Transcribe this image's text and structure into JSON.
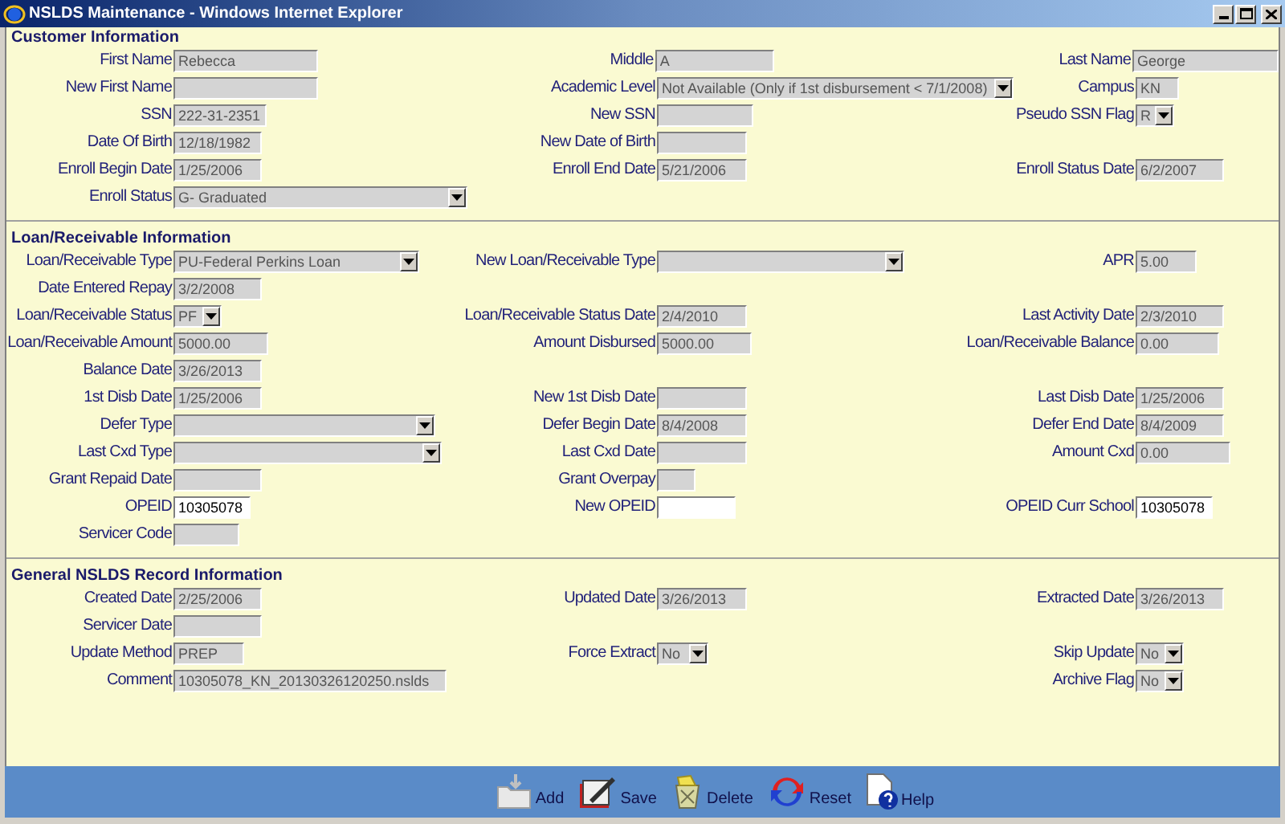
{
  "window": {
    "title": "NSLDS Maintenance - Windows Internet Explorer"
  },
  "sections": [
    {
      "title": "Customer Information",
      "rows": [
        [
          {
            "label": "First Name",
            "kind": "text",
            "value": "Rebecca"
          },
          {
            "label": "Middle",
            "kind": "text",
            "value": "A"
          },
          {
            "label": "Last Name",
            "kind": "text",
            "value": "George"
          }
        ],
        [
          {
            "label": "New First Name",
            "kind": "text"
          },
          {
            "label": "Academic Level",
            "kind": "select",
            "value": "Not Available (Only if 1st disbursement < 7/1/2008)"
          },
          {
            "label": "Campus",
            "kind": "text",
            "value": "KN"
          }
        ],
        [
          {
            "label": "SSN",
            "kind": "text",
            "value": "222-31-2351"
          },
          {
            "label": "New SSN",
            "kind": "text"
          },
          {
            "label": "Pseudo SSN Flag",
            "kind": "select",
            "value": "R"
          }
        ],
        [
          {
            "label": "Date Of Birth",
            "kind": "text",
            "value": "12/18/1982"
          },
          {
            "label": "New Date of Birth",
            "kind": "text"
          },
          null
        ],
        [
          {
            "label": "Enroll Begin Date",
            "kind": "text",
            "value": "1/25/2006"
          },
          {
            "label": "Enroll End Date",
            "kind": "text",
            "value": "5/21/2006"
          },
          {
            "label": "Enroll Status Date",
            "kind": "text",
            "value": "6/2/2007"
          }
        ],
        [
          {
            "label": "Enroll Status",
            "kind": "select",
            "value": "G- Graduated"
          },
          null,
          null
        ]
      ]
    },
    {
      "title": "Loan/Receivable Information",
      "rows": [
        [
          {
            "label": "Loan/Receivable Type",
            "kind": "select",
            "value": "PU-Federal Perkins Loan"
          },
          {
            "label": "New Loan/Receivable Type",
            "kind": "select"
          },
          {
            "label": "APR",
            "kind": "text",
            "value": "5.00"
          }
        ],
        [
          {
            "label": "Date Entered Repay",
            "kind": "text",
            "value": "3/2/2008"
          },
          null,
          null
        ],
        [
          {
            "label": "Loan/Receivable Status",
            "kind": "select",
            "value": "PF"
          },
          {
            "label": "Loan/Receivable Status Date",
            "kind": "text",
            "value": "2/4/2010"
          },
          {
            "label": "Last Activity Date",
            "kind": "text",
            "value": "2/3/2010"
          }
        ],
        [
          {
            "label": "Loan/Receivable Amount",
            "kind": "text",
            "value": "5000.00"
          },
          {
            "label": "Amount Disbursed",
            "kind": "text",
            "value": "5000.00"
          },
          {
            "label": "Loan/Receivable Balance",
            "kind": "text",
            "value": "0.00"
          }
        ],
        [
          {
            "label": "Balance Date",
            "kind": "text",
            "value": "3/26/2013"
          },
          null,
          null
        ],
        [
          {
            "label": "1st Disb Date",
            "kind": "text",
            "value": "1/25/2006"
          },
          {
            "label": "New 1st Disb Date",
            "kind": "text"
          },
          {
            "label": "Last Disb Date",
            "kind": "text",
            "value": "1/25/2006"
          }
        ],
        [
          {
            "label": "Defer Type",
            "kind": "select"
          },
          {
            "label": "Defer Begin Date",
            "kind": "text",
            "value": "8/4/2008"
          },
          {
            "label": "Defer End Date",
            "kind": "text",
            "value": "8/4/2009"
          }
        ],
        [
          {
            "label": "Last Cxd Type",
            "kind": "select"
          },
          {
            "label": "Last Cxd Date",
            "kind": "text"
          },
          {
            "label": "Amount Cxd",
            "kind": "text",
            "value": "0.00"
          }
        ],
        [
          {
            "label": "Grant Repaid Date",
            "kind": "text"
          },
          {
            "label": "Grant Overpay",
            "kind": "text"
          },
          null
        ],
        [
          {
            "label": "OPEID",
            "kind": "input",
            "value": "10305078"
          },
          {
            "label": "New OPEID",
            "kind": "input"
          },
          {
            "label": "OPEID Curr School",
            "kind": "input",
            "value": "10305078"
          }
        ],
        [
          {
            "label": "Servicer Code",
            "kind": "text"
          },
          null,
          null
        ]
      ]
    },
    {
      "title": "General NSLDS Record Information",
      "rows": [
        [
          {
            "label": "Created Date",
            "kind": "text",
            "value": "2/25/2006"
          },
          {
            "label": "Updated Date",
            "kind": "text",
            "value": "3/26/2013"
          },
          {
            "label": "Extracted Date",
            "kind": "text",
            "value": "3/26/2013"
          }
        ],
        [
          {
            "label": "Servicer Date",
            "kind": "text"
          },
          null,
          null
        ],
        [
          {
            "label": "Update Method",
            "kind": "text",
            "value": "PREP"
          },
          {
            "label": "Force Extract",
            "kind": "select",
            "value": "No"
          },
          {
            "label": "Skip Update",
            "kind": "select",
            "value": "No"
          }
        ],
        [
          {
            "label": "Comment",
            "kind": "text",
            "value": "10305078_KN_20130326120250.nslds"
          },
          null,
          {
            "label": "Archive Flag",
            "kind": "select",
            "value": "No"
          }
        ]
      ]
    }
  ],
  "toolbar": [
    {
      "label": "Add",
      "kind": "add"
    },
    {
      "label": "Save",
      "kind": "save"
    },
    {
      "label": "Delete",
      "kind": "delete"
    },
    {
      "label": "Reset",
      "kind": "reset"
    },
    {
      "label": "Help",
      "kind": "help"
    }
  ]
}
